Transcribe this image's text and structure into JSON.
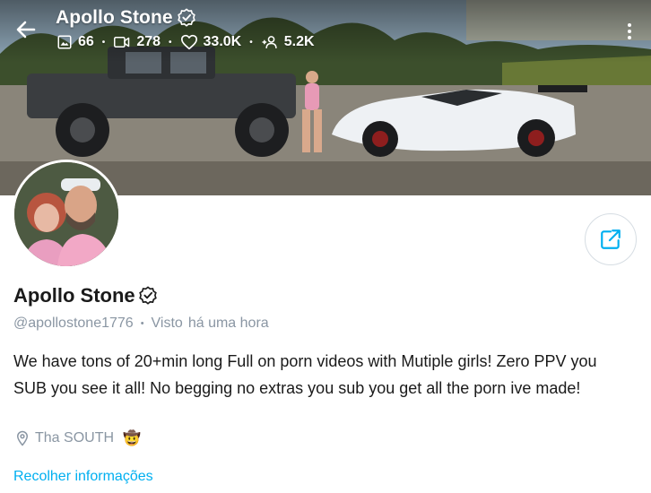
{
  "header": {
    "title": "Apollo Stone",
    "stats": [
      {
        "icon": "image-icon",
        "value": "66"
      },
      {
        "icon": "video-icon",
        "value": "278"
      },
      {
        "icon": "heart-icon",
        "value": "33.0K"
      },
      {
        "icon": "fans-icon",
        "value": "5.2K"
      }
    ],
    "separator": "•"
  },
  "profile": {
    "name": "Apollo Stone",
    "handle": "@apollostone1776",
    "separator": "•",
    "last_seen_label": "Visto",
    "last_seen_value": "há uma hora",
    "bio": "We have tons of 20+min long Full on porn videos with Mutiple girls! Zero PPV you SUB you see it all! No begging no extras you sub you get all the porn ive made!",
    "location": "Tha SOUTH",
    "location_emoji": "🤠",
    "collapse_label": "Recolher informações"
  },
  "colors": {
    "accent": "#00aff0",
    "muted_text": "#8a96a3",
    "primary_text": "#1a1a1a"
  }
}
